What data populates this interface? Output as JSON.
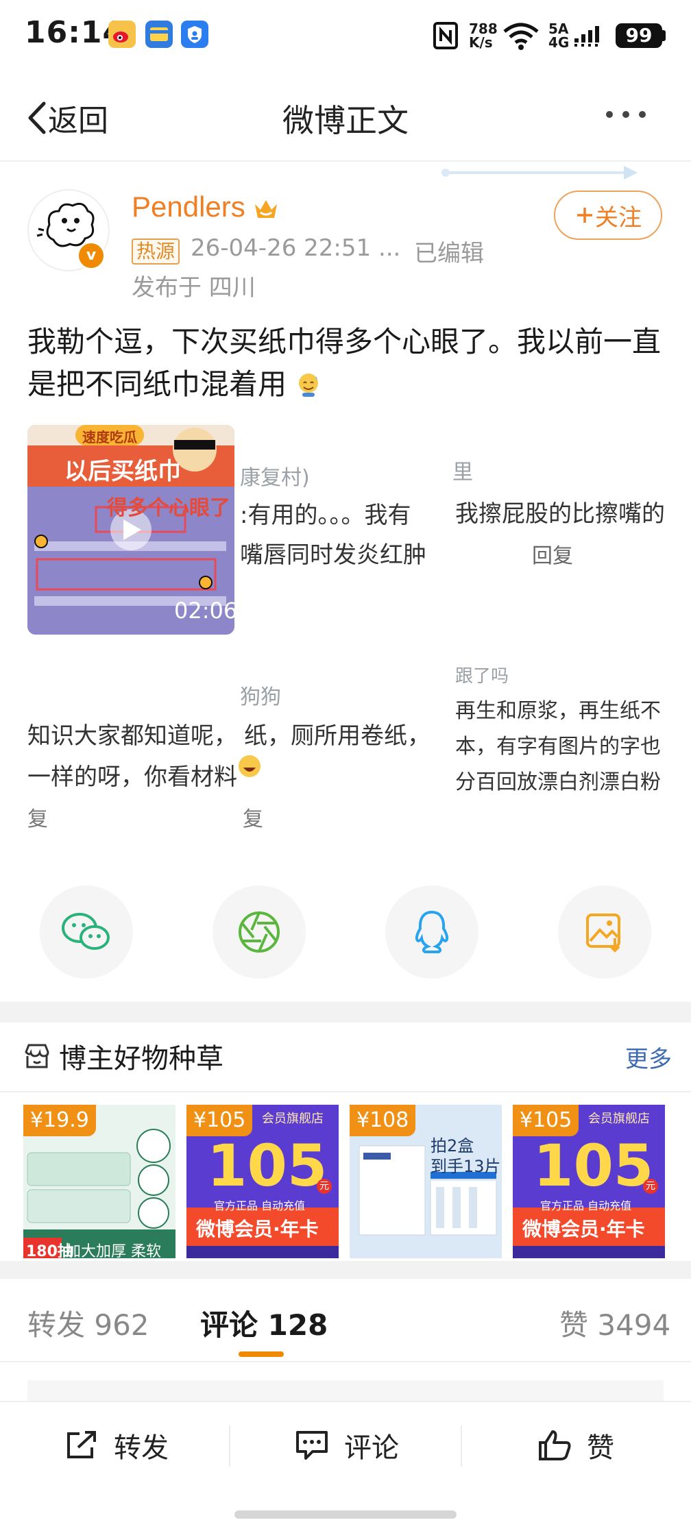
{
  "status_bar": {
    "time": "16:14",
    "network_speed_top": "788",
    "network_speed_bottom": "K/s",
    "signal_top": "5A",
    "signal_bottom": "4G",
    "battery": "99"
  },
  "nav": {
    "back_label": "返回",
    "title": "微博正文"
  },
  "author": {
    "name": "Pendlers",
    "hot_tag": "热源",
    "timestamp": "26-04-26 22:51",
    "ellipsis": "...",
    "edited": "已编辑",
    "location": "发布于 四川",
    "follow_label": "关注"
  },
  "post": {
    "text": "我勒个逗，下次买纸巾得多个心眼了。我以前一直是把不同纸巾混着用",
    "video": {
      "banner_small": "速度吃瓜",
      "banner_title": "以后买纸巾",
      "banner_sub": "得多个心眼了",
      "duration": "02:06"
    }
  },
  "ghost_comments": {
    "c1_name": "康复村)",
    "c1_line1": ":有用的。。。我有",
    "c1_line2": "嘴唇同时发炎红肿",
    "c2_name": "里",
    "c2_line1": "我擦屁股的比擦嘴的",
    "c2_reply": "回复",
    "c3_name": "狗狗",
    "c3_line1": "知识大家都知道呢，",
    "c3_line2": "一样的呀，你看材料",
    "c3_line1b": "纸，厕所用卷纸，",
    "c3_reply": "复",
    "c3_reply_left": "复",
    "c4_name": "跟了吗",
    "c4_line1": "再生和原浆，再生纸不",
    "c4_line2": "本，有字有图片的字也",
    "c4_line3": "分百回放漂白剂漂白粉"
  },
  "share": {
    "items": [
      "wechat-icon",
      "moments-icon",
      "qq-icon",
      "save-image-icon"
    ]
  },
  "goods": {
    "title": "博主好物种草",
    "more_label": "更多",
    "cards": [
      {
        "price": "¥19.9",
        "caption": "加大加厚 柔软亲肤",
        "badge": "180抽",
        "color": "#dff1ea"
      },
      {
        "price": "¥105",
        "store": "会员旗舰店",
        "big": "105",
        "unit": "元",
        "line1": "官方正品 自动充值",
        "line2": "微博会员·年卡",
        "color": "#5b3fd1"
      },
      {
        "price": "¥108",
        "headline": "拍2盒",
        "subline": "到手13片",
        "color": "#e9f2fb"
      },
      {
        "price": "¥105",
        "store": "会员旗舰店",
        "big": "105",
        "unit": "元",
        "line1": "官方正品 自动充值",
        "line2": "微博会员·年卡",
        "color": "#5b3fd1"
      }
    ]
  },
  "tabs": {
    "repost": "转发 962",
    "comment": "评论 128",
    "like": "赞 3494"
  },
  "bottom_bar": {
    "repost": "转发",
    "comment": "评论",
    "like": "赞"
  }
}
